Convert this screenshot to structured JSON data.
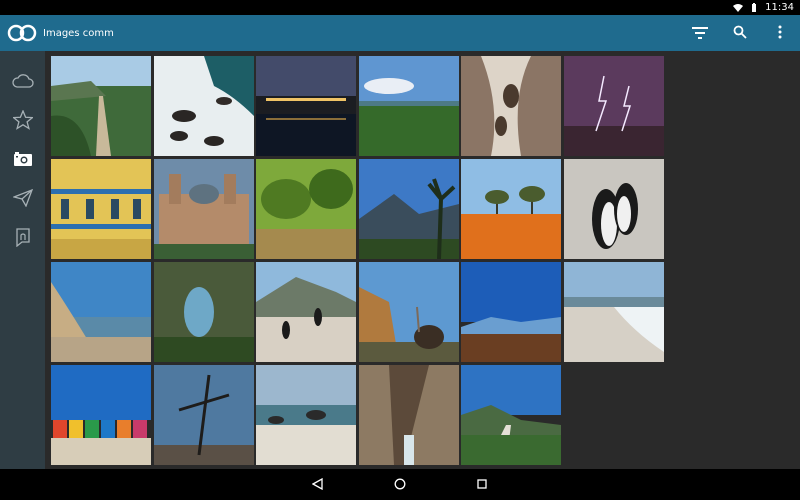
{
  "status_bar": {
    "time": "11:34"
  },
  "app_bar": {
    "title": "Images comm",
    "actions": [
      "sort-icon",
      "search-icon",
      "more-vert-icon"
    ]
  },
  "side_rail": {
    "items": [
      "cloud-icon",
      "star-icon",
      "camera-icon",
      "send-icon",
      "note-icon"
    ],
    "selected_index": 2
  },
  "colors": {
    "app_bar": "#1f6b8e",
    "side_rail": "#2f3d44",
    "content_bg": "#2a2a2a"
  },
  "gallery": {
    "tiles": [
      "coastal-boardwalk",
      "rocky-surf",
      "night-waterfront",
      "green-valley",
      "rock-pools-canyon",
      "lightning-storm",
      "victorian-building",
      "city-hall",
      "vineyard",
      "mountain-palm",
      "orange-wildflowers-trees",
      "penguins-pair",
      "beach-dune",
      "rock-arch",
      "penguins-beach",
      "ostriches",
      "blue-mountain-lake",
      "white-beach-surf",
      "beach-huts",
      "wooden-cross",
      "rocky-beach-cloudy",
      "gorge-waterfall",
      "coastal-road"
    ]
  },
  "nav_bar": {
    "buttons": [
      "back-icon",
      "home-icon",
      "recents-icon"
    ]
  }
}
